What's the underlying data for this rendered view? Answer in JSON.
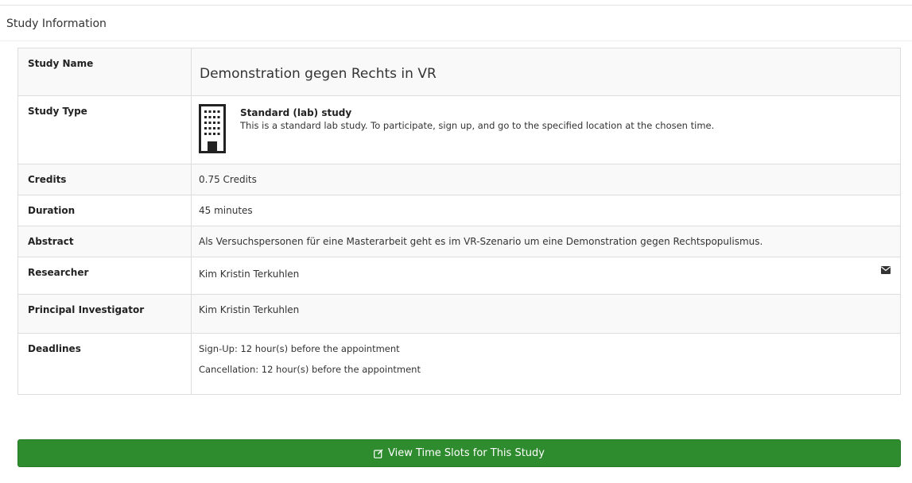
{
  "panel": {
    "title": "Study Information"
  },
  "rows": {
    "study_name": {
      "label": "Study Name",
      "value": "Demonstration gegen Rechts in VR"
    },
    "study_type": {
      "label": "Study Type",
      "icon": "building-icon",
      "title": "Standard (lab) study",
      "description": "This is a standard lab study. To participate, sign up, and go to the specified location at the chosen time."
    },
    "credits": {
      "label": "Credits",
      "value": "0.75 Credits"
    },
    "duration": {
      "label": "Duration",
      "value": "45 minutes"
    },
    "abstract": {
      "label": "Abstract",
      "value": "Als Versuchspersonen für eine Masterarbeit geht es im VR-Szenario um eine Demonstration gegen Rechtspopulismus."
    },
    "researcher": {
      "label": "Researcher",
      "value": "Kim Kristin Terkuhlen",
      "icon": "envelope-icon"
    },
    "pi": {
      "label": "Principal Investigator",
      "value": "Kim Kristin Terkuhlen"
    },
    "deadlines": {
      "label": "Deadlines",
      "signup": "Sign-Up:  12 hour(s) before the appointment",
      "cancellation": "Cancellation:  12 hour(s) before the appointment"
    }
  },
  "actions": {
    "view_slots_label": "View Time Slots for This Study",
    "view_slots_icon": "edit-icon",
    "button_color": "#2e8b2e"
  }
}
